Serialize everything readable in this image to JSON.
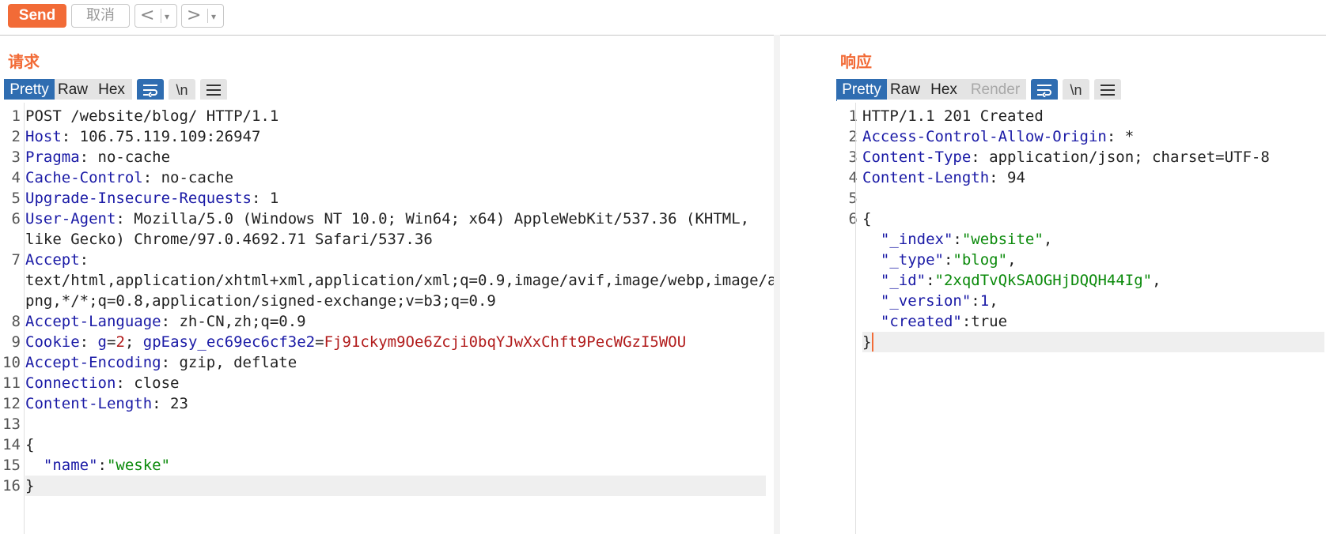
{
  "toolbar": {
    "send_label": "Send",
    "cancel_label": "取消",
    "back_glyph": "<",
    "forward_glyph": ">",
    "dropdown_glyph": "▾"
  },
  "request": {
    "title": "请求",
    "tabs": [
      "Pretty",
      "Raw",
      "Hex"
    ],
    "active_tab": "Pretty",
    "newline_label": "\\n",
    "lines": [
      {
        "n": "1",
        "parts": [
          [
            "POST /website/blog/ HTTP/1.1",
            ""
          ]
        ]
      },
      {
        "n": "2",
        "parts": [
          [
            "Host",
            "k"
          ],
          [
            ": 106.75.119.109:26947",
            ""
          ]
        ]
      },
      {
        "n": "3",
        "parts": [
          [
            "Pragma",
            "k"
          ],
          [
            ": no-cache",
            ""
          ]
        ]
      },
      {
        "n": "4",
        "parts": [
          [
            "Cache-Control",
            "k"
          ],
          [
            ": no-cache",
            ""
          ]
        ]
      },
      {
        "n": "5",
        "parts": [
          [
            "Upgrade-Insecure-Requests",
            "k"
          ],
          [
            ": 1",
            ""
          ]
        ]
      },
      {
        "n": "6",
        "parts": [
          [
            "User-Agent",
            "k"
          ],
          [
            ": Mozilla/5.0 (Windows NT 10.0; Win64; x64) AppleWebKit/537.36 (KHTML,",
            ""
          ]
        ]
      },
      {
        "n": "",
        "parts": [
          [
            "like Gecko) Chrome/97.0.4692.71 Safari/537.36",
            ""
          ]
        ]
      },
      {
        "n": "7",
        "parts": [
          [
            "Accept",
            "k"
          ],
          [
            ":",
            ""
          ]
        ]
      },
      {
        "n": "",
        "parts": [
          [
            "text/html,application/xhtml+xml,application/xml;q=0.9,image/avif,image/webp,image/a",
            ""
          ]
        ]
      },
      {
        "n": "",
        "parts": [
          [
            "png,*/*;q=0.8,application/signed-exchange;v=b3;q=0.9",
            ""
          ]
        ]
      },
      {
        "n": "8",
        "parts": [
          [
            "Accept-Language",
            "k"
          ],
          [
            ": zh-CN,zh;q=0.9",
            ""
          ]
        ]
      },
      {
        "n": "9",
        "parts": [
          [
            "Cookie",
            "k"
          ],
          [
            ": ",
            ""
          ],
          [
            "g",
            "ck"
          ],
          [
            "=",
            ""
          ],
          [
            "2",
            "cv"
          ],
          [
            "; ",
            ""
          ],
          [
            "gpEasy_ec69ec6cf3e2",
            "ck"
          ],
          [
            "=",
            ""
          ],
          [
            "Fj91ckym9Oe6Zcji0bqYJwXxChft9PecWGzI5WOU",
            "cv"
          ]
        ]
      },
      {
        "n": "10",
        "parts": [
          [
            "Accept-Encoding",
            "k"
          ],
          [
            ": gzip, deflate",
            ""
          ]
        ]
      },
      {
        "n": "11",
        "parts": [
          [
            "Connection",
            "k"
          ],
          [
            ": close",
            ""
          ]
        ]
      },
      {
        "n": "12",
        "parts": [
          [
            "Content-Length",
            "k"
          ],
          [
            ": 23",
            ""
          ]
        ]
      },
      {
        "n": "13",
        "parts": []
      },
      {
        "n": "14",
        "parts": [
          [
            "{",
            ""
          ]
        ]
      },
      {
        "n": "15",
        "parts": [
          [
            "  ",
            ""
          ],
          [
            "\"name\"",
            "k"
          ],
          [
            ":",
            ""
          ],
          [
            "\"weske\"",
            "s"
          ]
        ]
      },
      {
        "n": "16",
        "parts": [
          [
            "}",
            ""
          ]
        ]
      }
    ]
  },
  "response": {
    "title": "响应",
    "tabs": [
      "Pretty",
      "Raw",
      "Hex",
      "Render"
    ],
    "active_tab": "Pretty",
    "disabled_tab": "Render",
    "newline_label": "\\n",
    "lines": [
      {
        "n": "1",
        "parts": [
          [
            "HTTP/1.1 201 Created",
            ""
          ]
        ]
      },
      {
        "n": "2",
        "parts": [
          [
            "Access-Control-Allow-Origin",
            "k"
          ],
          [
            ": *",
            ""
          ]
        ]
      },
      {
        "n": "3",
        "parts": [
          [
            "Content-Type",
            "k"
          ],
          [
            ": application/json; charset=UTF-8",
            ""
          ]
        ]
      },
      {
        "n": "4",
        "parts": [
          [
            "Content-Length",
            "k"
          ],
          [
            ": 94",
            ""
          ]
        ]
      },
      {
        "n": "5",
        "parts": []
      },
      {
        "n": "6",
        "parts": [
          [
            "{",
            ""
          ]
        ]
      },
      {
        "n": "",
        "parts": [
          [
            "  ",
            ""
          ],
          [
            "\"_index\"",
            "k"
          ],
          [
            ":",
            ""
          ],
          [
            "\"website\"",
            "s"
          ],
          [
            ",",
            ""
          ]
        ]
      },
      {
        "n": "",
        "parts": [
          [
            "  ",
            ""
          ],
          [
            "\"_type\"",
            "k"
          ],
          [
            ":",
            ""
          ],
          [
            "\"blog\"",
            "s"
          ],
          [
            ",",
            ""
          ]
        ]
      },
      {
        "n": "",
        "parts": [
          [
            "  ",
            ""
          ],
          [
            "\"_id\"",
            "k"
          ],
          [
            ":",
            ""
          ],
          [
            "\"2xqdTvQkSAOGHjDQQH44Ig\"",
            "s"
          ],
          [
            ",",
            ""
          ]
        ]
      },
      {
        "n": "",
        "parts": [
          [
            "  ",
            ""
          ],
          [
            "\"_version\"",
            "k"
          ],
          [
            ":",
            ""
          ],
          [
            "1",
            "n"
          ],
          [
            ",",
            ""
          ]
        ]
      },
      {
        "n": "",
        "parts": [
          [
            "  ",
            ""
          ],
          [
            "\"created\"",
            "k"
          ],
          [
            ":true",
            ""
          ]
        ]
      },
      {
        "n": "",
        "parts": [
          [
            "}",
            ""
          ]
        ]
      }
    ]
  }
}
